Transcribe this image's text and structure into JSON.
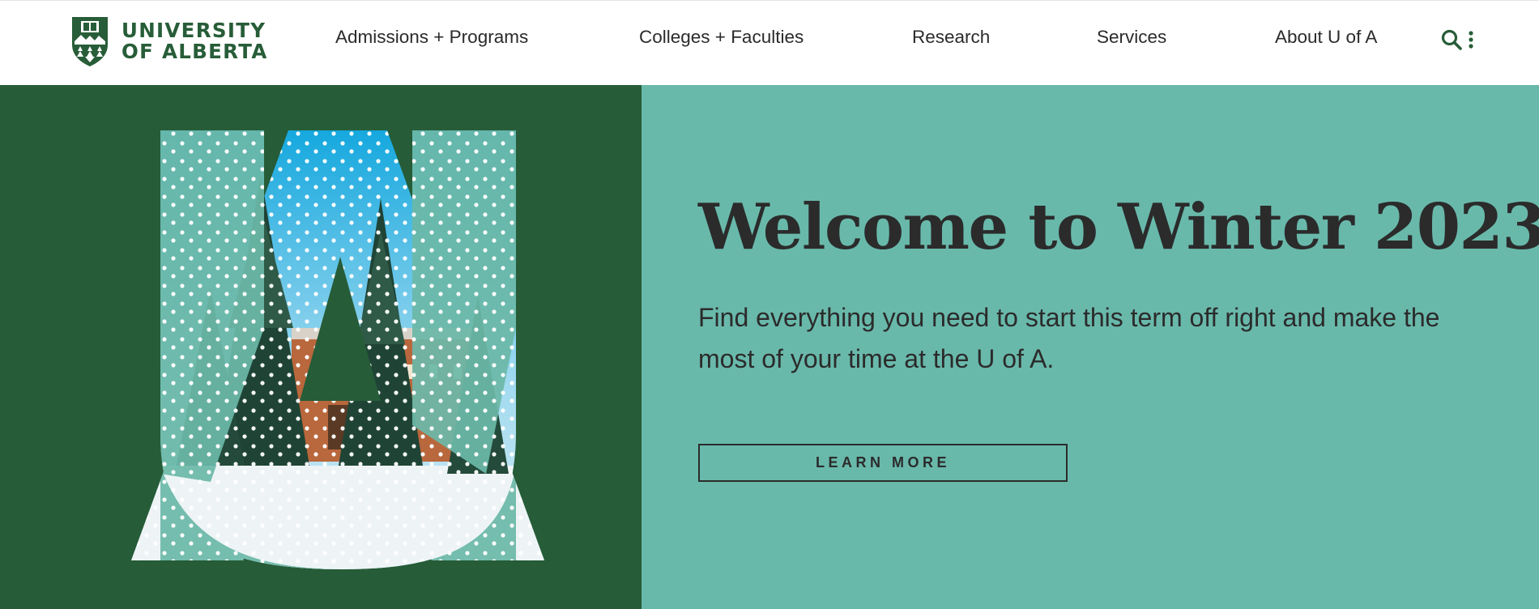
{
  "header": {
    "logo": {
      "line1": "UNIVERSITY",
      "line2": "OF ALBERTA",
      "crest_icon": "university-crest-icon"
    },
    "nav": [
      {
        "label": "Admissions + Programs"
      },
      {
        "label": "Colleges + Faculties"
      },
      {
        "label": "Research"
      },
      {
        "label": "Services"
      },
      {
        "label": "About U of A"
      }
    ],
    "utility": {
      "search_icon": "search-icon",
      "more_icon": "kebab-menu-icon"
    }
  },
  "hero": {
    "title": "Welcome to Winter 2023",
    "text": "Find everything you need to start this term off right and make the most of your time at the U of A.",
    "button_label": "LEARN MORE",
    "artwork": "winter-campus-ua-letters-image"
  },
  "colors": {
    "brand_green": "#275d38",
    "hero_left_bg": "#265c38",
    "hero_right_bg": "#69b9ab",
    "text_dark": "#2b2b2b"
  }
}
